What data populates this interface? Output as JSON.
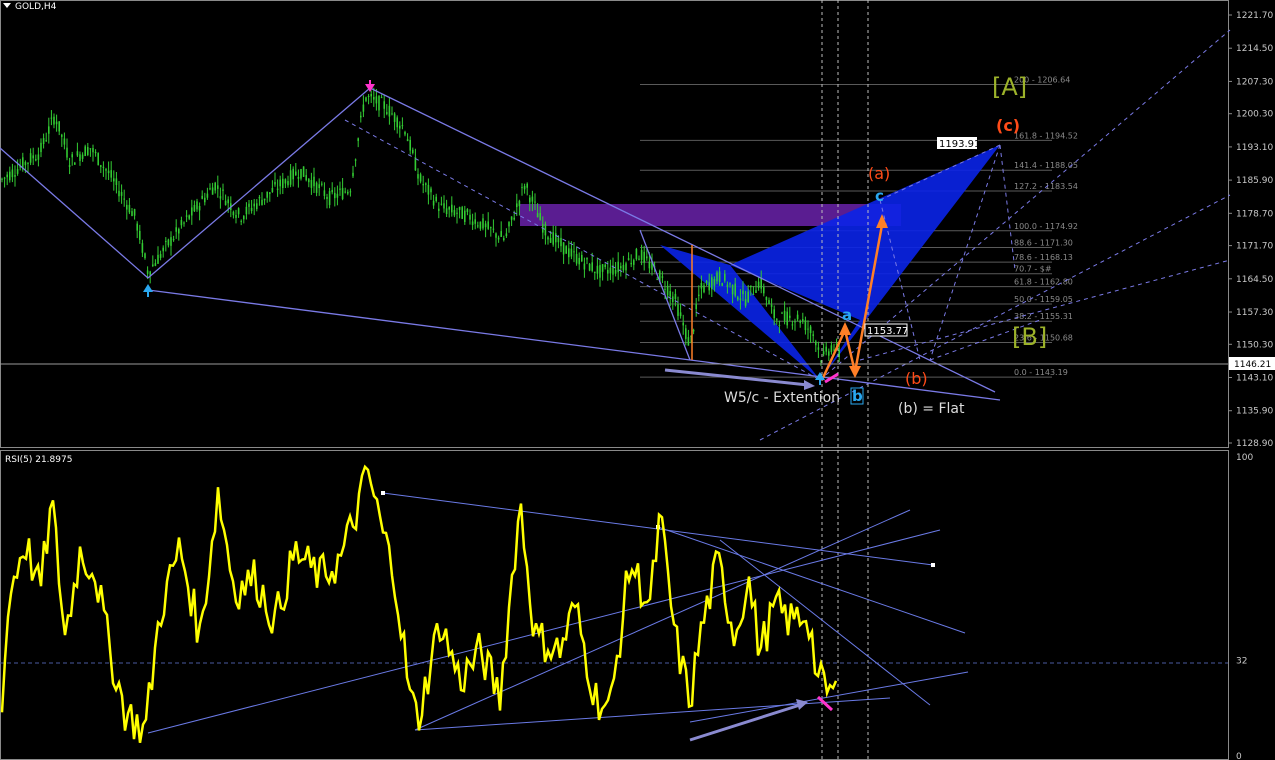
{
  "header": {
    "symbol": "GOLD,H4",
    "rsi_label": "RSI(5) 21.8975"
  },
  "chart_data": [
    {
      "type": "candlestick",
      "title": "GOLD,H4",
      "ylim": [
        1128.9,
        1221.7
      ],
      "price_ticks": [
        "1221.70",
        "1214.50",
        "1207.30",
        "1200.30",
        "1193.10",
        "1185.90",
        "1178.70",
        "1171.70",
        "1164.50",
        "1157.30",
        "1150.30",
        "1143.10",
        "1135.90",
        "1128.90"
      ],
      "current_price": "1146.21",
      "fib_levels": [
        {
          "label": "200 - 1206.64",
          "value": 1206.64
        },
        {
          "label": "161.8 - 1194.52",
          "value": 1194.52
        },
        {
          "label": "141.4 - 1188.05",
          "value": 1188.05
        },
        {
          "label": "127.2 - 1183.54",
          "value": 1183.54
        },
        {
          "label": "100.0 - 1174.92",
          "value": 1174.92
        },
        {
          "label": "88.6 - 1171.30",
          "value": 1171.3
        },
        {
          "label": "78.6 - 1168.13",
          "value": 1168.13
        },
        {
          "label": "70.7 - $#",
          "value": 1165.6
        },
        {
          "label": "61.8 - 1162.80",
          "value": 1162.8
        },
        {
          "label": "50.0 - 1159.05",
          "value": 1159.05
        },
        {
          "label": "38.2 - 1155.31",
          "value": 1155.31
        },
        {
          "label": "23.6 - 1150.68",
          "value": 1150.68
        },
        {
          "label": "0.0 - 1143.19",
          "value": 1143.19
        }
      ],
      "price_boxes": [
        "1193.91",
        "1153.77"
      ],
      "annotations": {
        "wave_A": "[A]",
        "wave_B": "[B]",
        "wave_c_big": "(c)",
        "wave_a_big": "(a)",
        "wave_b_big": "(b)",
        "wave_a_small": "a",
        "wave_b_small": "b",
        "wave_c_small": "c",
        "extension": "W5/c - Extention",
        "flat": "(b) = Flat"
      }
    },
    {
      "type": "line",
      "title": "RSI(5) 21.8975",
      "ylim": [
        0,
        100
      ],
      "y_ticks": [
        "100",
        "32",
        "0"
      ],
      "level": 32
    }
  ],
  "colors": {
    "background": "#000000",
    "candle": "#33cc33",
    "rsi": "#ffff00",
    "trendline": "#7a7ae6",
    "harmonic": "#0a24e8",
    "zone": "#6a22aa",
    "orange": "#ff7f27",
    "cyan_label": "#2aa8f0",
    "olive_label": "#9cb22a"
  }
}
